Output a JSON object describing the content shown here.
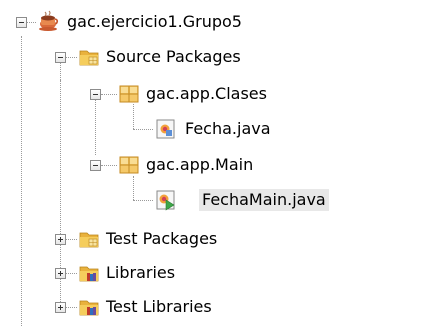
{
  "project_tree": {
    "nodes": [
      {
        "label": "gac.ejercicio1.Grupo5",
        "icon": "coffee-cup-project-icon",
        "state": "expanded"
      },
      {
        "label": "Source Packages",
        "icon": "source-packages-folder-icon",
        "state": "expanded"
      },
      {
        "label": "gac.app.Clases",
        "icon": "package-icon",
        "state": "expanded"
      },
      {
        "label": "Fecha.java",
        "icon": "java-class-icon",
        "state": "leaf"
      },
      {
        "label": "gac.app.Main",
        "icon": "package-icon",
        "state": "expanded"
      },
      {
        "label": "FechaMain.java",
        "icon": "java-main-class-icon",
        "state": "leaf",
        "selected": true
      },
      {
        "label": "Test Packages",
        "icon": "test-packages-folder-icon",
        "state": "collapsed"
      },
      {
        "label": "Libraries",
        "icon": "libraries-folder-icon",
        "state": "collapsed"
      },
      {
        "label": "Test Libraries",
        "icon": "test-libraries-folder-icon",
        "state": "collapsed"
      }
    ]
  },
  "colors": {
    "connector": "#9a9a9a",
    "folder_yellow": "#f0c34a",
    "package_yellow": "#f2b84b",
    "selection_bg": "#e8e8e8"
  }
}
